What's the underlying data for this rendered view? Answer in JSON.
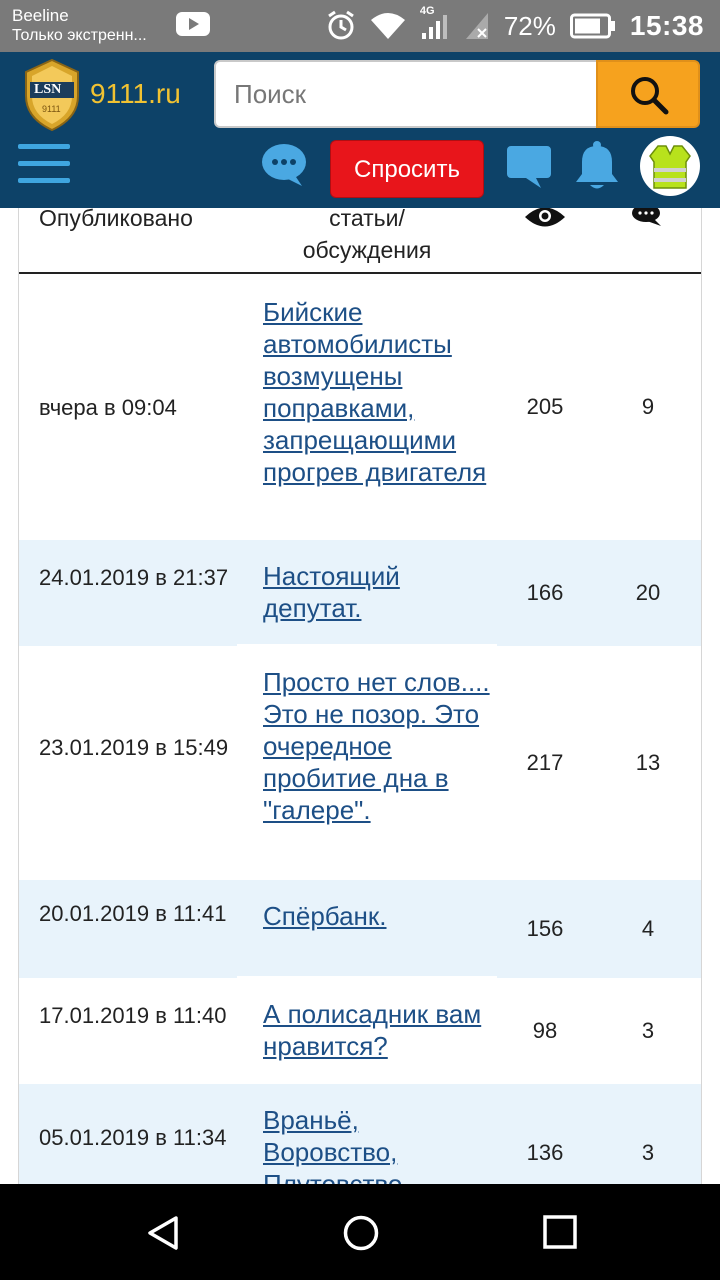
{
  "status_bar": {
    "carrier": "Beeline",
    "notice": "Только экстренн...",
    "network": "4G",
    "battery": "72%",
    "time": "15:38"
  },
  "header": {
    "logo_text": "LSN",
    "logo_sub": "9111",
    "site_name": "9111.ru",
    "search_placeholder": "Поиск",
    "ask_label": "Спросить",
    "brand_color": "#0d4268",
    "accent_color": "#f6a21e",
    "ask_color": "#e8151b"
  },
  "table": {
    "headers": {
      "date": "Опубликовано",
      "title": "статьи/\nобсуждения",
      "views_icon": "eye-icon",
      "comments_icon": "comments-icon"
    },
    "rows": [
      {
        "date": "вчера в 09:04",
        "title": "Бийские автомобилисты возмущены поправками, запрещающими прогрев двигателя",
        "views": "205",
        "comments": "9"
      },
      {
        "date": "24.01.2019 в 21:37",
        "title": "Настоящий депутат.",
        "views": "166",
        "comments": "20"
      },
      {
        "date": "23.01.2019 в 15:49",
        "title": "Просто нет слов.... Это не позор. Это очередное пробитие дна в \"галере\".",
        "views": "217",
        "comments": "13"
      },
      {
        "date": "20.01.2019 в 11:41",
        "title": "Спёрбанк.",
        "views": "156",
        "comments": "4"
      },
      {
        "date": "17.01.2019 в 11:40",
        "title": "А полисадник вам нравится?",
        "views": "98",
        "comments": "3"
      },
      {
        "date": "05.01.2019 в 11:34",
        "title": "Враньё, Воровство, Плутовство",
        "views": "136",
        "comments": "3"
      }
    ]
  },
  "nav": {
    "back": "back-icon",
    "home": "home-icon",
    "recents": "recents-icon"
  }
}
